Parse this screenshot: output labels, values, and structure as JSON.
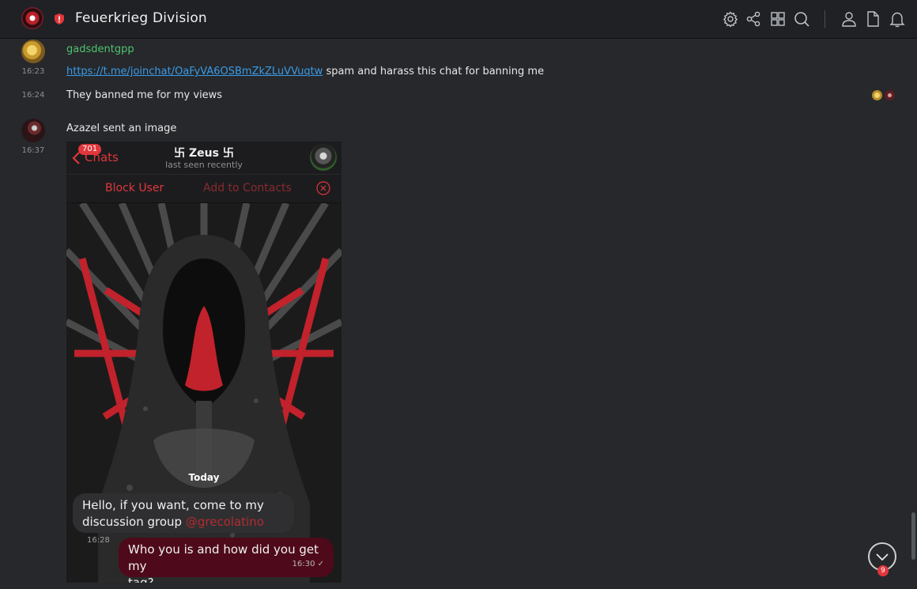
{
  "header": {
    "title": "Feuerkrieg Division",
    "icons": [
      "settings-icon",
      "share-icon",
      "grid-icon",
      "search-icon",
      "user-icon",
      "file-icon",
      "bell-icon"
    ]
  },
  "messages": [
    {
      "username": "gadsdentgpp",
      "time": "16:23",
      "link": "https://t.me/joinchat/OaFyVA6OSBmZkZLuVVuqtw",
      "text": "spam and harass this chat for banning me"
    },
    {
      "time": "16:24",
      "text": "They banned me for my views"
    },
    {
      "time": "16:37",
      "text": "Azazel sent an image"
    }
  ],
  "embedded_image": {
    "badge": "701",
    "back_label": "Chats",
    "contact_name": "卐 Zeus 卐",
    "status": "last seen recently",
    "block_label": "Block User",
    "add_label": "Add to Contacts",
    "date_label": "Today",
    "bubble_in_line1": "Hello, if you want, come to my",
    "bubble_in_line2": "discussion group",
    "bubble_in_mention": "@grecolatino",
    "bubble_in_time": "16:28",
    "bubble_out_line1": "Who you is and how did you get my",
    "bubble_out_line2": "tag?",
    "bubble_out_time": "16:30"
  },
  "scroll": {
    "badge": "9"
  },
  "colors": {
    "background": "#26282b",
    "username": "#4fc36f",
    "link": "#3b9be8",
    "alert": "#e0373c"
  }
}
